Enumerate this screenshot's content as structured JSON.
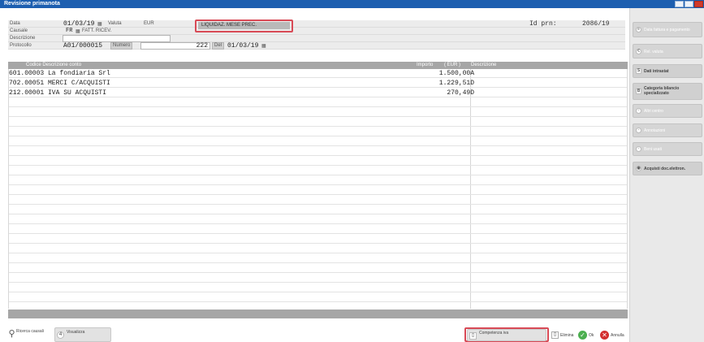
{
  "window": {
    "title": "Revisione primanota"
  },
  "header": {
    "data_label": "Data",
    "data_value": "01/03/19",
    "valuta_label": "Valuta",
    "valuta_value": "EUR",
    "liquidaz": "LIQUIDAZ. MESE PREC.",
    "id_label": "Id prn:",
    "id_value": "2086/19",
    "causale_label": "Causale",
    "causale_code": "FR",
    "causale_desc": "FATT. RICEV.",
    "descrizione_label": "Descrizione",
    "descrizione_value": "",
    "protocollo_label": "Protocollo",
    "protocollo_value": "A01/000015",
    "numero_label": "Numero",
    "numero_value": "222",
    "del_label": "Del",
    "del_value": "01/03/19"
  },
  "grid": {
    "columns": [
      "Codice Descrizione conto",
      "Importo",
      "( EUR )",
      "Descrizione"
    ],
    "rows": [
      {
        "code": "601.00003 La fondiaria Srl",
        "amount": "1.500,00A",
        "desc": ""
      },
      {
        "code": "702.00051 MERCI C/ACQUISTI",
        "amount": "1.229,51D",
        "desc": ""
      },
      {
        "code": "212.00001 IVA SU ACQUISTI",
        "amount": "270,49D",
        "desc": ""
      }
    ]
  },
  "sidebar": {
    "buttons": [
      {
        "label": "Data fattura e pagamento",
        "enabled": false,
        "icon": "calendar-icon",
        "glyph": "≡"
      },
      {
        "label": "Rel. valuta",
        "enabled": false,
        "icon": "currency-icon",
        "glyph": "€"
      },
      {
        "label": "Dati intrastat",
        "enabled": true,
        "icon": "intrastat-icon",
        "glyph": "S"
      },
      {
        "label": "Categoria bilancio specializzato",
        "enabled": true,
        "icon": "balance-icon",
        "glyph": "B"
      },
      {
        "label": "Altri centro",
        "enabled": false,
        "icon": "cost-center-icon",
        "glyph": "◦"
      },
      {
        "label": "Annotazioni",
        "enabled": false,
        "icon": "notes-icon",
        "glyph": "◦"
      },
      {
        "label": "Beni usati",
        "enabled": false,
        "icon": "used-goods-icon",
        "glyph": "◦"
      },
      {
        "label": "Acquisti doc.elettron.",
        "enabled": true,
        "icon": "e-invoice-icon",
        "glyph": "◉"
      }
    ]
  },
  "bottom": {
    "ricerca_label": "Ricerca causali",
    "visualizza_label": "Visualizza",
    "competenza_label": "Competenza iva",
    "elimina_label": "Elimina",
    "ok_label": "Ok",
    "annulla_label": "Annulla"
  },
  "colors": {
    "titlebar": "#1d5fb0",
    "highlight": "#d84a56",
    "ok": "#4caf50",
    "cancel": "#d32f2f"
  }
}
